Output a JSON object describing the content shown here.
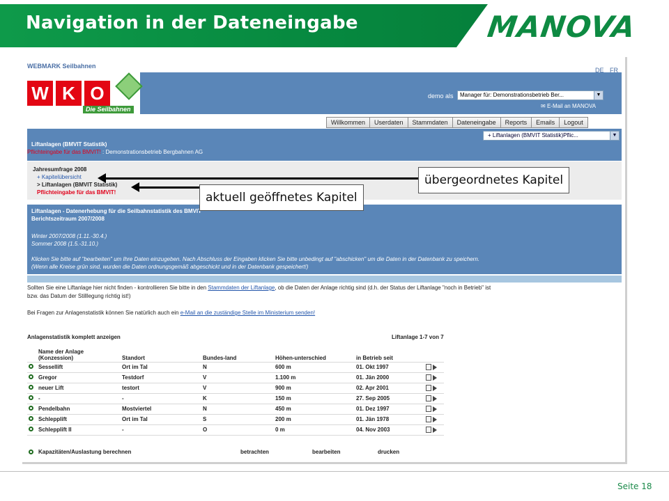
{
  "slide": {
    "title": "Navigation in der Dateneingabe",
    "brand": "MANOVA",
    "page_label": "Seite 18",
    "accent_color": "#0e8a42"
  },
  "app": {
    "site_title": "WEBMARK Seilbahnen",
    "lang_de": "DE",
    "lang_fr": "FR",
    "wko_letters": [
      "W",
      "K",
      "O"
    ],
    "wko_sub": "Die Seilbahnen",
    "demo_label": "demo als",
    "demo_select": "Manager für: Demonstrationsbetrieb Ber...",
    "email_link": "E-Mail an MANOVA",
    "nav_tabs": [
      "Willkommen",
      "Userdaten",
      "Stammdaten",
      "Dateneingabe",
      "Reports",
      "Emails",
      "Logout"
    ],
    "chapter_select": "+ Liftanlagen (BMVIT Statistik)Pflic...",
    "section_title": "Liftanlagen (BMVIT Statistik)",
    "pflicht_red": "Pflichteingabe für das BMVIT!",
    "pflicht_company": " : Demonstrationsbetrieb Bergbahnen AG",
    "jahr_title": "Jahresumfrage 2008",
    "jahr_items": [
      "+ Kapitelübersicht",
      "> Liftanlagen (BMVIT Statistik)",
      "Pflichteingabe für das BMVIT!"
    ],
    "info_title": "Liftanlagen - Datenerhebung für die Seilbahnstatistik des BMVIT",
    "info_sub": "Berichtszeitraum 2007/2008",
    "winter": "Winter 2007/2008 (1.11.-30.4.)",
    "sommer": "Sommer 2008 (1.5.-31.10.)",
    "info_p1": "Klicken Sie bitte auf \"bearbeiten\" um Ihre Daten einzugeben. Nach Abschluss der Eingaben klicken Sie bitte unbedingt auf \"abschicken\" um die Daten in der Datenbank zu speichern.",
    "info_p2": "(Wenn alle Kreise grün sind, wurden die Daten ordnungsgemäß abgeschickt und in der Datenbank gespeichert!)",
    "body_p1a": "Sollten Sie eine Liftanlage hier nicht finden - kontrollieren Sie bitte in den ",
    "body_p1_link": "Stammdaten der Liftanlage",
    "body_p1b": ", ob die Daten der Anlage richtig sind (d.h. der Status der Liftanlage \"noch in Betrieb\" ist",
    "body_p1c": "bzw. das Datum der Stilllegung richtig ist!)",
    "body_p2a": "Bei Fragen zur Anlagenstatistik können Sie natürlich auch ein ",
    "body_p2_link": "e-Mail an die zuständige Stelle im Ministerium senden!",
    "stats_title": "Anlagenstatistik komplett anzeigen",
    "stats_count": "Liftanlage 1-7 von 7",
    "table_headers": [
      "Name der Anlage (Konzession)",
      "Standort",
      "Bundes-land",
      "Höhen-unterschied",
      "in Betrieb seit"
    ],
    "table_rows": [
      [
        "Sessellift",
        "Ort im Tal",
        "N",
        "600 m",
        "01. Okt 1997"
      ],
      [
        "Gregor",
        "Testdorf",
        "V",
        "1.100 m",
        "01. Jän 2000"
      ],
      [
        "neuer Lift",
        "testort",
        "V",
        "900 m",
        "02. Apr 2001"
      ],
      [
        "-",
        "-",
        "K",
        "150 m",
        "27. Sep 2005"
      ],
      [
        "Pendelbahn",
        "Mostviertel",
        "N",
        "450 m",
        "01. Dez 1997"
      ],
      [
        "Schlepplift",
        "Ort im Tal",
        "S",
        "200 m",
        "01. Jän 1978"
      ],
      [
        "Schlepplift II",
        "-",
        "O",
        "0 m",
        "04. Nov 2003"
      ]
    ],
    "kap_label": "Kapazitäten/Auslastung berechnen",
    "kap_actions": [
      "betrachten",
      "bearbeiten",
      "drucken"
    ]
  },
  "callouts": {
    "parent": "übergeordnetes Kapitel",
    "current": "aktuell geöffnetes Kapitel"
  }
}
